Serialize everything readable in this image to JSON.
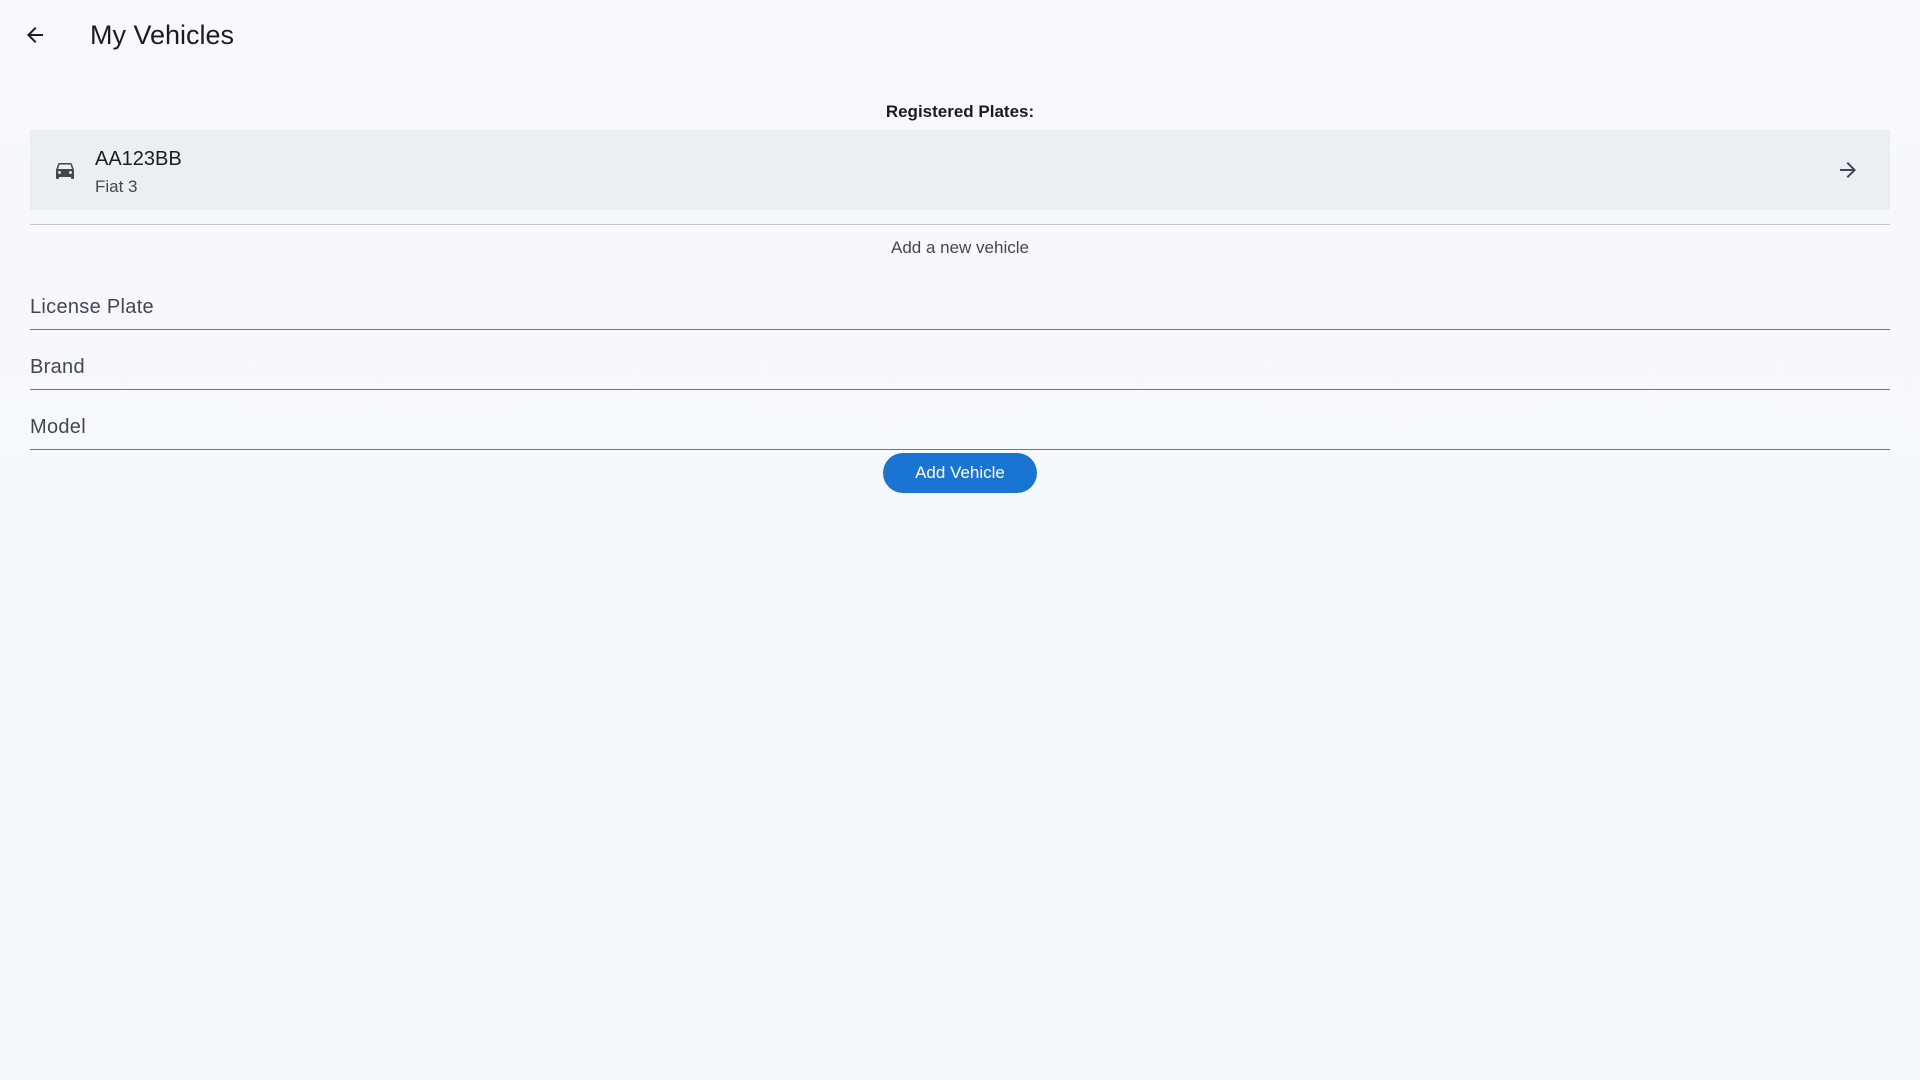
{
  "app_bar": {
    "title": "My Vehicles",
    "back_icon": "arrow-back-icon"
  },
  "registered": {
    "heading": "Registered Plates:",
    "vehicles": [
      {
        "plate": "AA123BB",
        "subtitle": "Fiat 3",
        "leading_icon": "car-icon",
        "trailing_icon": "arrow-forward-icon"
      }
    ]
  },
  "add_form": {
    "heading": "Add a new vehicle",
    "license_plate": {
      "placeholder": "License Plate",
      "value": ""
    },
    "brand": {
      "placeholder": "Brand",
      "value": ""
    },
    "model": {
      "placeholder": "Model",
      "value": ""
    },
    "submit_label": "Add Vehicle"
  },
  "colors": {
    "primary": "#1a74d2",
    "tile_background": "#e9eff3",
    "page_background": "#f5f9fc"
  }
}
